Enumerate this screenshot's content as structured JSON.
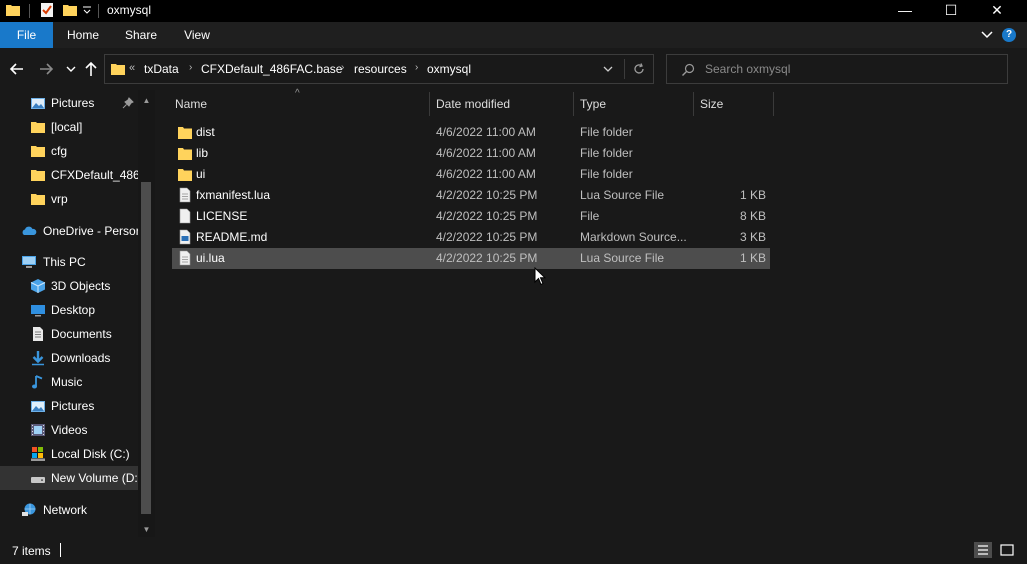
{
  "window": {
    "title": "oxmysql",
    "minimize_glyph": "—",
    "maximize_glyph": "☐",
    "close_glyph": "✕"
  },
  "ribbon": {
    "tabs": [
      {
        "label": "File"
      },
      {
        "label": "Home"
      },
      {
        "label": "Share"
      },
      {
        "label": "View"
      }
    ],
    "help_glyph": "?"
  },
  "address": {
    "overflow_glyph": "«",
    "crumbs": [
      "txData",
      "CFXDefault_486FAC.base",
      "resources",
      "oxmysql"
    ],
    "separator": "›"
  },
  "search": {
    "placeholder": "Search oxmysql"
  },
  "sidebar": {
    "items": [
      {
        "label": "Pictures",
        "icon": "pictures-icon",
        "pinned": true
      },
      {
        "label": "[local]",
        "icon": "folder-icon"
      },
      {
        "label": "cfg",
        "icon": "folder-icon"
      },
      {
        "label": "CFXDefault_486F",
        "icon": "folder-icon"
      },
      {
        "label": "vrp",
        "icon": "folder-icon"
      },
      {
        "label": "OneDrive - Persor",
        "icon": "onedrive-icon"
      },
      {
        "label": "This PC",
        "icon": "this-pc-icon"
      },
      {
        "label": "3D Objects",
        "icon": "3d-objects-icon"
      },
      {
        "label": "Desktop",
        "icon": "desktop-icon"
      },
      {
        "label": "Documents",
        "icon": "documents-icon"
      },
      {
        "label": "Downloads",
        "icon": "downloads-icon"
      },
      {
        "label": "Music",
        "icon": "music-icon"
      },
      {
        "label": "Pictures",
        "icon": "pictures-icon"
      },
      {
        "label": "Videos",
        "icon": "videos-icon"
      },
      {
        "label": "Local Disk (C:)",
        "icon": "local-disk-icon"
      },
      {
        "label": "New Volume (D:",
        "icon": "drive-icon",
        "selected": true
      },
      {
        "label": "Network",
        "icon": "network-icon"
      }
    ]
  },
  "file_list": {
    "columns": [
      "Name",
      "Date modified",
      "Type",
      "Size"
    ],
    "sort_glyph": "^",
    "rows": [
      {
        "name": "dist",
        "date": "4/6/2022 11:00 AM",
        "type": "File folder",
        "size": "",
        "icon": "folder-icon"
      },
      {
        "name": "lib",
        "date": "4/6/2022 11:00 AM",
        "type": "File folder",
        "size": "",
        "icon": "folder-icon"
      },
      {
        "name": "ui",
        "date": "4/6/2022 11:00 AM",
        "type": "File folder",
        "size": "",
        "icon": "folder-icon"
      },
      {
        "name": "fxmanifest.lua",
        "date": "4/2/2022 10:25 PM",
        "type": "Lua Source File",
        "size": "1 KB",
        "icon": "lua-file-icon"
      },
      {
        "name": "LICENSE",
        "date": "4/2/2022 10:25 PM",
        "type": "File",
        "size": "8 KB",
        "icon": "file-icon"
      },
      {
        "name": "README.md",
        "date": "4/2/2022 10:25 PM",
        "type": "Markdown Source...",
        "size": "3 KB",
        "icon": "markdown-file-icon"
      },
      {
        "name": "ui.lua",
        "date": "4/2/2022 10:25 PM",
        "type": "Lua Source File",
        "size": "1 KB",
        "icon": "lua-file-icon",
        "selected": true
      }
    ]
  },
  "status": {
    "item_count": "7 items"
  },
  "colors": {
    "accent": "#1979ca",
    "folder": "#ffd35c",
    "background": "#191919",
    "selection": "#4d4d4d"
  }
}
